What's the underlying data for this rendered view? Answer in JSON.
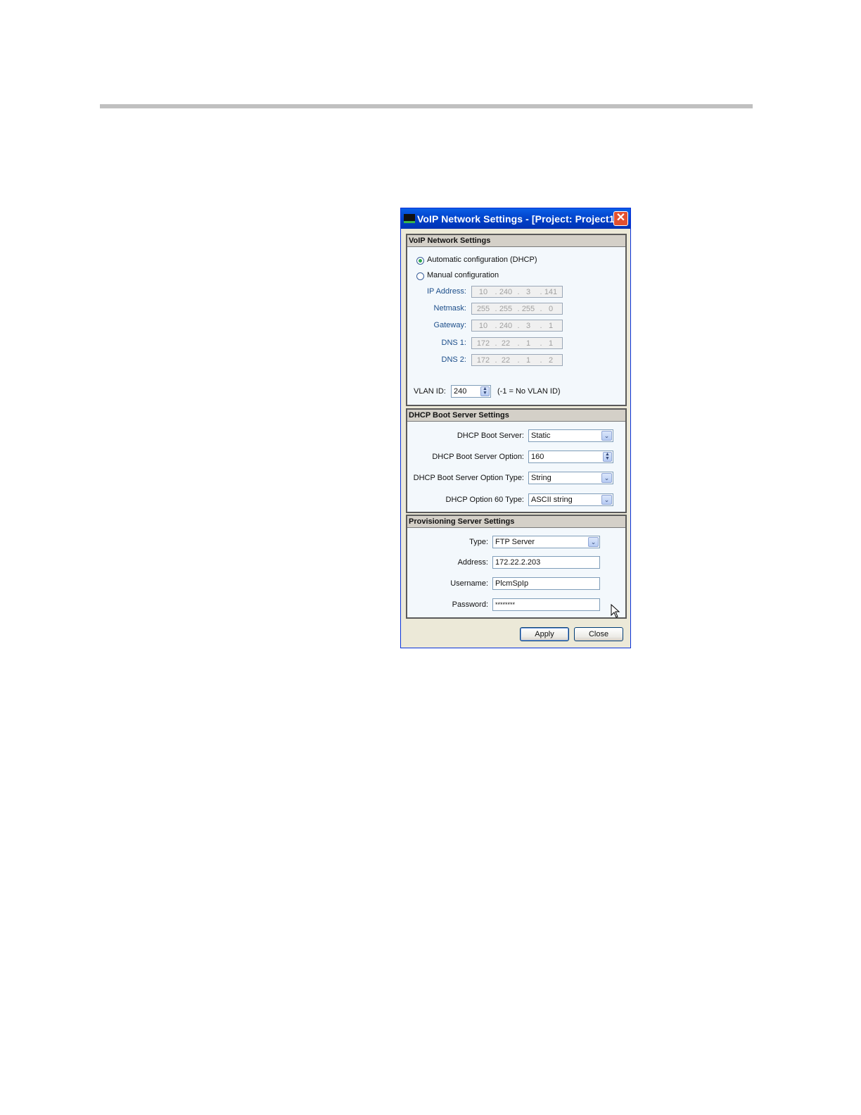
{
  "window": {
    "title": "VoIP Network Settings - [Project: Project1, ...",
    "close_glyph": "✕"
  },
  "voip_section": {
    "header": "VoIP Network Settings",
    "radio_auto": {
      "label": "Automatic configuration (DHCP)",
      "checked": true
    },
    "radio_manual": {
      "label": "Manual configuration",
      "checked": false
    },
    "fields": [
      {
        "label": "IP Address:",
        "octets": [
          "10",
          "240",
          "3",
          "141"
        ]
      },
      {
        "label": "Netmask:",
        "octets": [
          "255",
          "255",
          "255",
          "0"
        ]
      },
      {
        "label": "Gateway:",
        "octets": [
          "10",
          "240",
          "3",
          "1"
        ]
      },
      {
        "label": "DNS 1:",
        "octets": [
          "172",
          "22",
          "1",
          "1"
        ]
      },
      {
        "label": "DNS 2:",
        "octets": [
          "172",
          "22",
          "1",
          "2"
        ]
      }
    ],
    "dot": ".",
    "vlan_label": "VLAN ID:",
    "vlan_value": "240",
    "vlan_hint": "(-1 = No VLAN ID)"
  },
  "dhcp_section": {
    "header": "DHCP Boot Server Settings",
    "boot_server_label": "DHCP Boot Server:",
    "boot_server_value": "Static",
    "option_label": "DHCP Boot Server Option:",
    "option_value": "160",
    "option_type_label": "DHCP Boot Server Option Type:",
    "option_type_value": "String",
    "option60_label": "DHCP Option 60 Type:",
    "option60_value": "ASCII string"
  },
  "prov_section": {
    "header": "Provisioning Server Settings",
    "type_label": "Type:",
    "type_value": "FTP Server",
    "address_label": "Address:",
    "address_value": "172.22.2.203",
    "username_label": "Username:",
    "username_value": "PlcmSpIp",
    "password_label": "Password:",
    "password_value": "********"
  },
  "buttons": {
    "apply": "Apply",
    "close": "Close"
  },
  "icons": {
    "dropdown": "chevron-down-icon",
    "spin_up": "▲",
    "spin_down": "▼",
    "dropdown_glyph": "⌄"
  },
  "colors": {
    "titlebar": "#0040c8",
    "close": "#e2502f",
    "radio_dot": "#2fa84f",
    "label_blue": "#1c4e8a"
  }
}
